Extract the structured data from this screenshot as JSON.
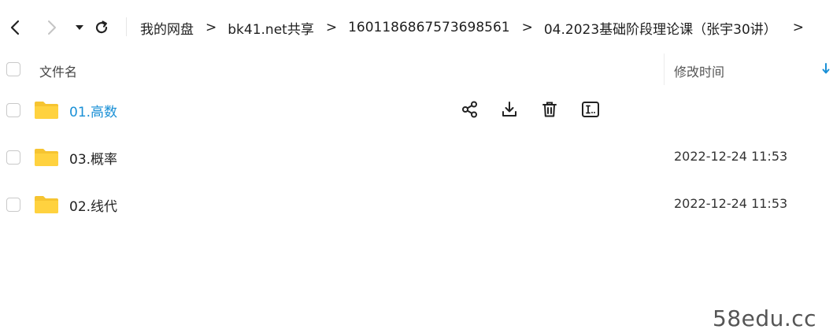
{
  "breadcrumb": [
    "我的网盘",
    "bk41.net共享",
    "1601186867573698561",
    "04.2023基础阶段理论课（张宇30讲）"
  ],
  "breadcrumb_separator": ">",
  "header": {
    "name_label": "文件名",
    "time_label": "修改时间"
  },
  "files": [
    {
      "name": "01.高数",
      "time": ""
    },
    {
      "name": "03.概率",
      "time": "2022-12-24 11:53"
    },
    {
      "name": "02.线代",
      "time": "2022-12-24 11:53"
    }
  ],
  "watermark": "58edu.cc",
  "colors": {
    "accent": "#1a90d6",
    "folder": "#ffd23f",
    "text": "#222222"
  }
}
